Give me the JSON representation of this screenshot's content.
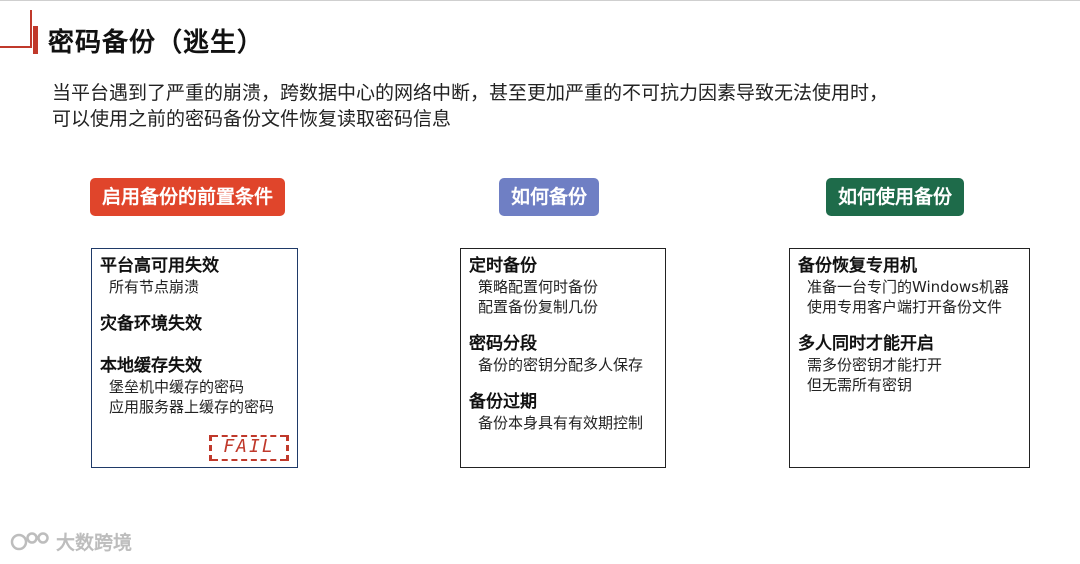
{
  "slide": {
    "title": "密码备份（逃生）",
    "description_lines": [
      "当平台遇到了严重的崩溃，跨数据中心的网络中断，甚至更加严重的不可抗力因素导致无法使用时，",
      "可以使用之前的密码备份文件恢复读取密码信息"
    ]
  },
  "columns": [
    {
      "badge": "启用备份的前置条件",
      "badge_color": "#e0452b",
      "sections": [
        {
          "title": "平台高可用失效",
          "lines": [
            "所有节点崩溃"
          ]
        },
        {
          "title": "灾备环境失效",
          "lines": []
        },
        {
          "title": "本地缓存失效",
          "lines": [
            "堡垒机中缓存的密码",
            "应用服务器上缓存的密码"
          ]
        }
      ],
      "stamp": "FAIL"
    },
    {
      "badge": "如何备份",
      "badge_color": "#6f7fc4",
      "sections": [
        {
          "title": "定时备份",
          "lines": [
            "策略配置何时备份",
            "配置备份复制几份"
          ]
        },
        {
          "title": "密码分段",
          "lines": [
            "备份的密钥分配多人保存"
          ]
        },
        {
          "title": "备份过期",
          "lines": [
            "备份本身具有有效期控制"
          ]
        }
      ]
    },
    {
      "badge": "如何使用备份",
      "badge_color": "#1e6b4a",
      "sections": [
        {
          "title": "备份恢复专用机",
          "lines": [
            "准备一台专门的Windows机器",
            "使用专用客户端打开备份文件"
          ]
        },
        {
          "title": "多人同时才能开启",
          "lines": [
            "需多份密钥才能打开",
            "但无需所有密钥"
          ]
        }
      ]
    }
  ],
  "watermark": {
    "text": "大数跨境",
    "icon": "logo-icon"
  }
}
